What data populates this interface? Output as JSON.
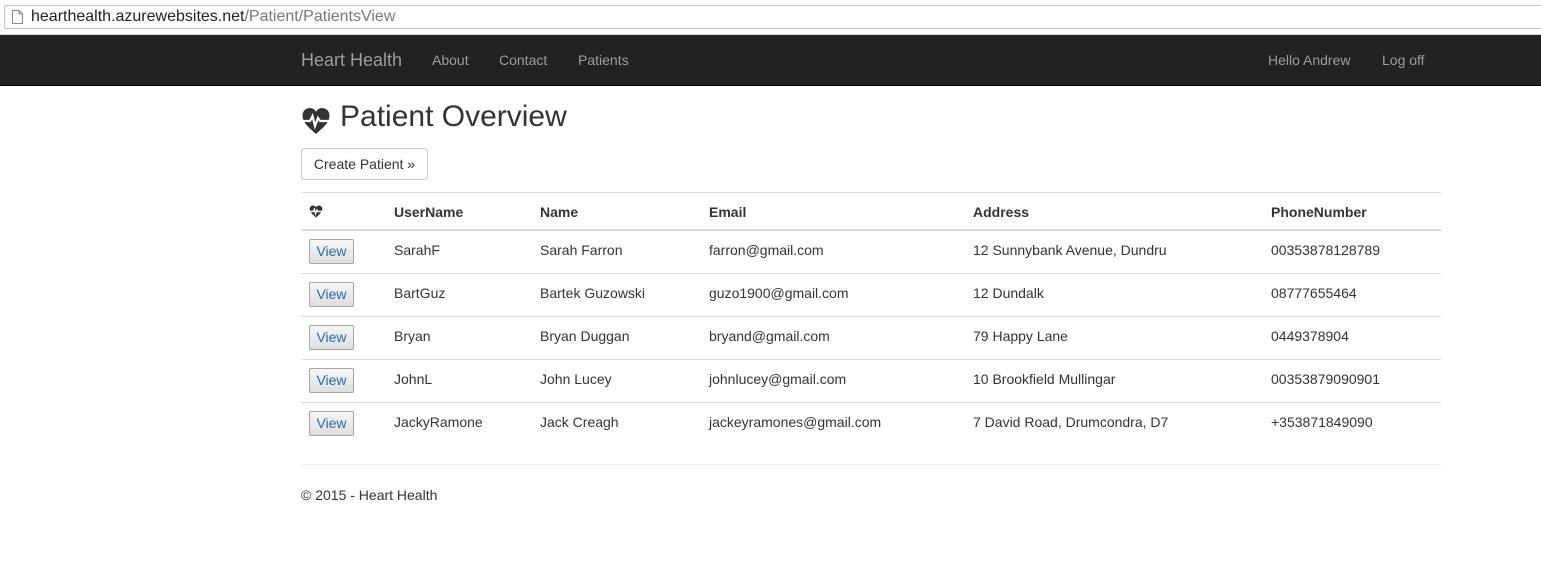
{
  "browser": {
    "url_host": "hearthealth.azurewebsites.net",
    "url_path": "/Patient/PatientsView",
    "page_icon": "page-icon"
  },
  "navbar": {
    "brand": "Heart Health",
    "links": [
      "About",
      "Contact",
      "Patients"
    ],
    "greeting": "Hello Andrew",
    "logoff": "Log off",
    "bg_color": "#222222"
  },
  "main": {
    "title": "Patient Overview",
    "title_icon": "heartbeat-icon",
    "create_button": "Create Patient »",
    "table": {
      "headers": [
        "UserName",
        "Name",
        "Email",
        "Address",
        "PhoneNumber"
      ],
      "header_icon": "heartbeat-icon",
      "view_label": "View",
      "rows": [
        {
          "username": "SarahF",
          "name": "Sarah Farron",
          "email": "farron@gmail.com",
          "address": "12 Sunnybank Avenue, Dundru",
          "phone": "00353878128789"
        },
        {
          "username": "BartGuz",
          "name": "Bartek Guzowski",
          "email": "guzo1900@gmail.com",
          "address": "12 Dundalk",
          "phone": "08777655464"
        },
        {
          "username": "Bryan",
          "name": "Bryan Duggan",
          "email": "bryand@gmail.com",
          "address": "79 Happy Lane",
          "phone": "0449378904"
        },
        {
          "username": "JohnL",
          "name": "John Lucey",
          "email": "johnlucey@gmail.com",
          "address": "10 Brookfield Mullingar",
          "phone": "00353879090901"
        },
        {
          "username": "JackyRamone",
          "name": "Jack Creagh",
          "email": "jackeyramones@gmail.com",
          "address": "7 David Road, Drumcondra, D7",
          "phone": "+353871849090"
        }
      ]
    }
  },
  "footer": {
    "text": "© 2015 - Heart Health"
  }
}
